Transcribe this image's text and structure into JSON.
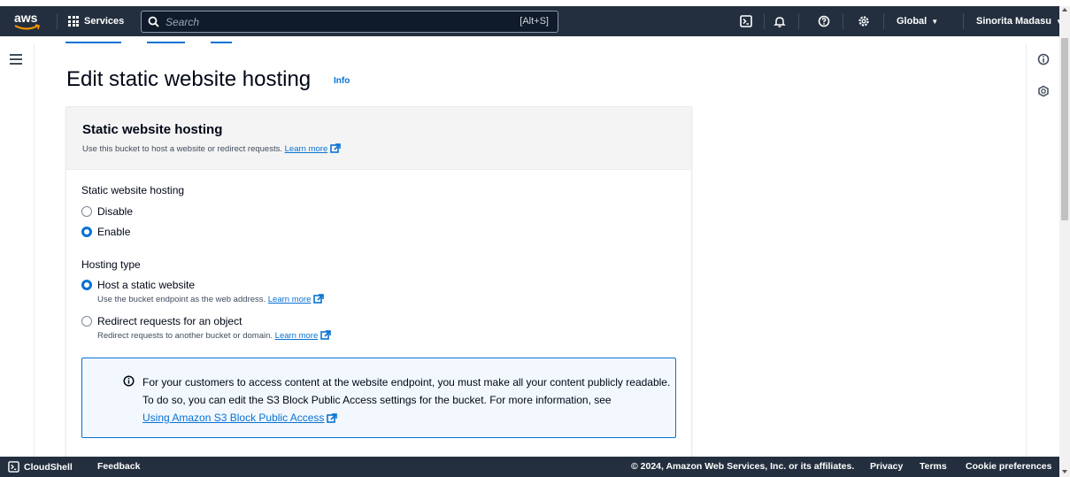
{
  "header": {
    "logo_text": "aws",
    "services_label": "Services",
    "search_placeholder": "Search",
    "search_shortcut": "[Alt+S]",
    "region_label": "Global",
    "user_label": "Sinorita Madasu"
  },
  "main": {
    "page_title": "Edit static website hosting",
    "info_label": "Info"
  },
  "panel": {
    "title": "Static website hosting",
    "description": "Use this bucket to host a website or redirect requests.",
    "learn_more": "Learn more",
    "hosting_field_label": "Static website hosting",
    "hosting_options": [
      {
        "label": "Disable",
        "selected": false
      },
      {
        "label": "Enable",
        "selected": true
      }
    ],
    "type_field_label": "Hosting type",
    "type_options": [
      {
        "label": "Host a static website",
        "description": "Use the bucket endpoint as the web address.",
        "learn_more": "Learn more",
        "selected": true
      },
      {
        "label": "Redirect requests for an object",
        "description": "Redirect requests to another bucket or domain.",
        "learn_more": "Learn more",
        "selected": false
      }
    ],
    "alert": {
      "text": "For your customers to access content at the website endpoint, you must make all your content publicly readable. To do so, you can edit the S3 Block Public Access settings for the bucket. For more information, see",
      "link": "Using Amazon S3 Block Public Access"
    }
  },
  "footer": {
    "cloudshell": "CloudShell",
    "feedback": "Feedback",
    "copyright": "© 2024, Amazon Web Services, Inc. or its affiliates.",
    "privacy": "Privacy",
    "terms": "Terms",
    "cookies": "Cookie preferences"
  },
  "colors": {
    "nav_bg": "#232f3e",
    "link": "#0972d3",
    "panel_head_bg": "#f4f4f4",
    "alert_bg": "#f2f8fd"
  }
}
